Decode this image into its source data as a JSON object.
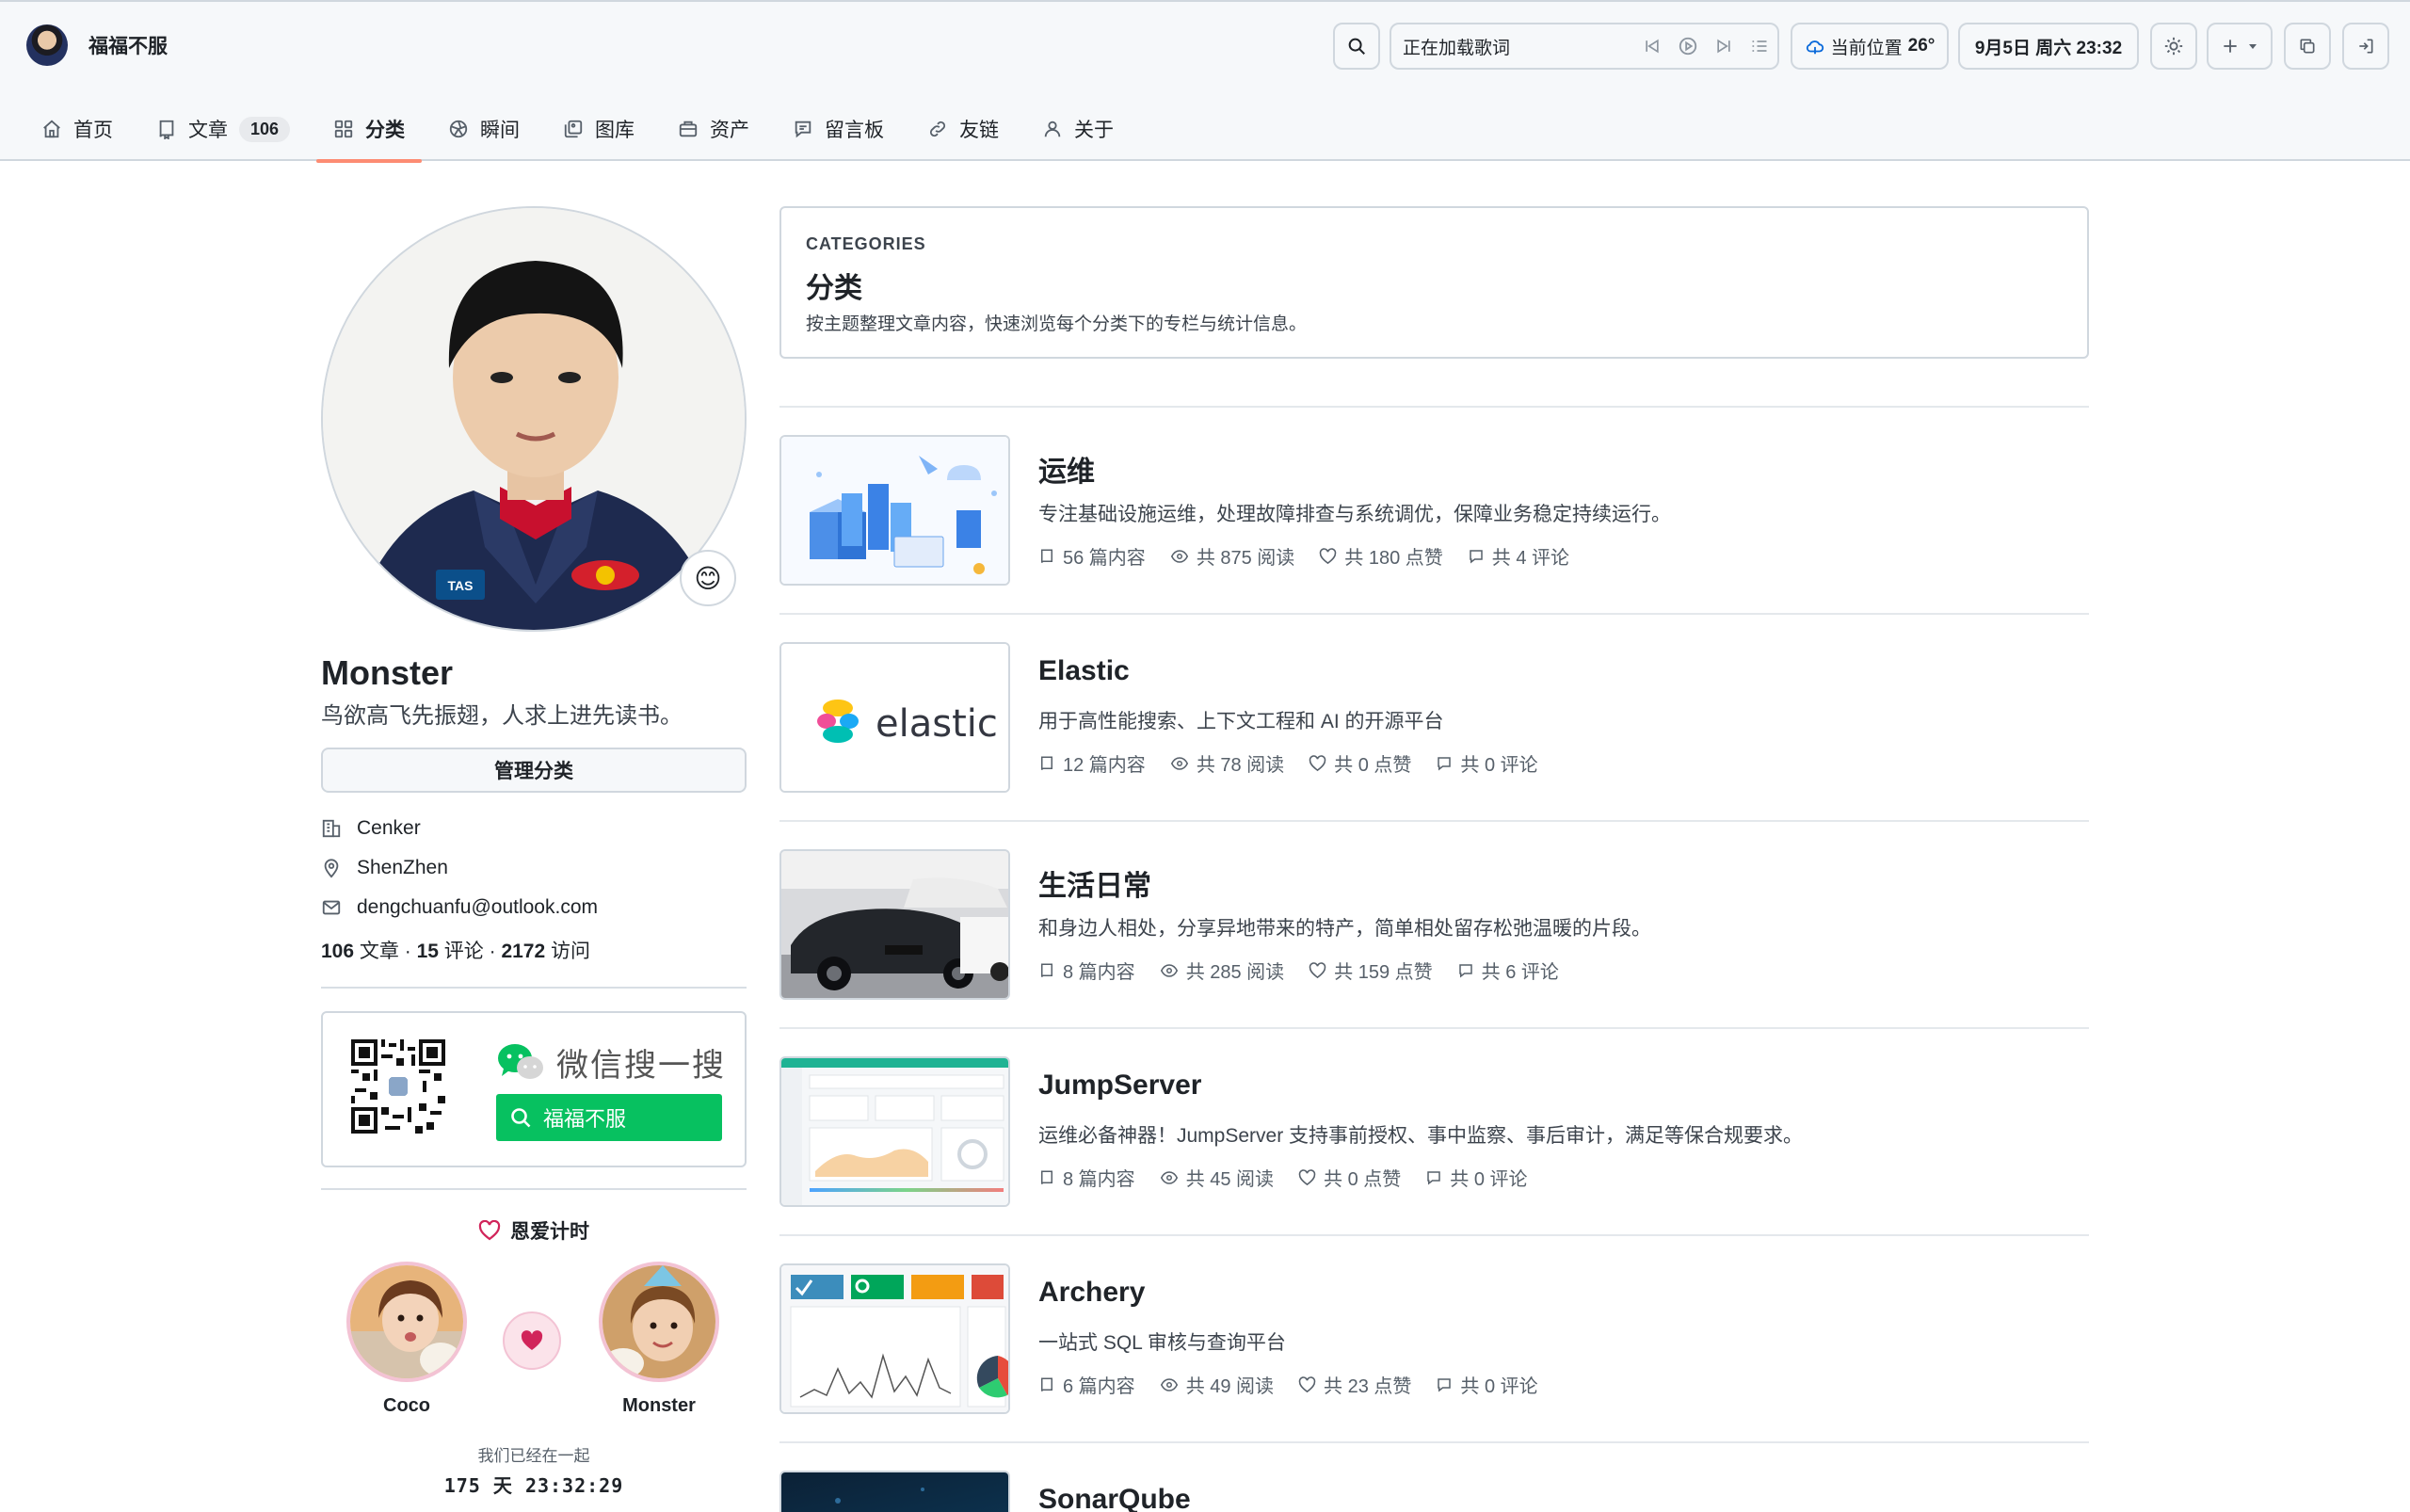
{
  "site": {
    "name": "福福不服"
  },
  "header": {
    "lyric": "正在加载歌词",
    "weather_label": "当前位置",
    "weather_temp": "26°",
    "datetime": "9月5日 周六 23:32"
  },
  "nav": [
    {
      "label": "首页",
      "icon": "home-icon"
    },
    {
      "label": "文章",
      "icon": "book-icon",
      "count": "106"
    },
    {
      "label": "分类",
      "icon": "grid-icon",
      "active": true
    },
    {
      "label": "瞬间",
      "icon": "aperture-icon"
    },
    {
      "label": "图库",
      "icon": "gallery-icon"
    },
    {
      "label": "资产",
      "icon": "briefcase-icon"
    },
    {
      "label": "留言板",
      "icon": "comment-icon"
    },
    {
      "label": "友链",
      "icon": "link-icon"
    },
    {
      "label": "关于",
      "icon": "person-icon"
    }
  ],
  "profile": {
    "name": "Monster",
    "bio": "鸟欲高飞先振翅，人求上进先读书。",
    "manage_label": "管理分类",
    "company": "Cenker",
    "location": "ShenZhen",
    "email": "dengchuanfu@outlook.com",
    "articles": "106",
    "articles_label": "文章",
    "comments": "15",
    "comments_label": "评论",
    "visits": "2172",
    "visits_label": "访问",
    "emoji": "😊"
  },
  "wechat": {
    "title": "微信搜一搜",
    "search_text": "福福不服"
  },
  "love": {
    "title": "恩爱计时",
    "left_name": "Coco",
    "right_name": "Monster",
    "since_label": "我们已经在一起",
    "days": "175",
    "days_unit": "天",
    "time": "23:32:29"
  },
  "categories_header": {
    "eyebrow": "CATEGORIES",
    "title": "分类",
    "description": "按主题整理文章内容，快速浏览每个分类下的专栏与统计信息。"
  },
  "categories": [
    {
      "name": "运维",
      "description": "专注基础设施运维，处理故障排查与系统调优，保障业务稳定持续运行。",
      "posts": "56 篇内容",
      "reads": "共 875 阅读",
      "likes": "共 180 点赞",
      "comments": "共 4 评论",
      "thumb": "isometric-servers"
    },
    {
      "name": "Elastic",
      "description": "用于高性能搜索、上下文工程和 AI 的开源平台",
      "posts": "12 篇内容",
      "reads": "共 78 阅读",
      "likes": "共 0 点赞",
      "comments": "共 0 评论",
      "thumb": "elastic-logo",
      "thumb_text": "elastic"
    },
    {
      "name": "生活日常",
      "description": "和身边人相处，分享异地带来的特产，简单相处留存松弛温暖的片段。",
      "posts": "8 篇内容",
      "reads": "共 285 阅读",
      "likes": "共 159 点赞",
      "comments": "共 6 评论",
      "thumb": "car-showroom"
    },
    {
      "name": "JumpServer",
      "description": "运维必备神器！JumpServer 支持事前授权、事中监察、事后审计，满足等保合规要求。",
      "posts": "8 篇内容",
      "reads": "共 45 阅读",
      "likes": "共 0 点赞",
      "comments": "共 0 评论",
      "thumb": "dashboard"
    },
    {
      "name": "Archery",
      "description": "一站式 SQL 审核与查询平台",
      "posts": "6 篇内容",
      "reads": "共 49 阅读",
      "likes": "共 23 点赞",
      "comments": "共 0 评论",
      "thumb": "archery-dashboard"
    },
    {
      "name": "SonarQube",
      "thumb": "dark-tech"
    }
  ],
  "colors": {
    "accent": "#fd8c73",
    "wechat_green": "#07c160",
    "elastic_yellow": "#fec514",
    "elastic_pink": "#f04e98",
    "elastic_teal": "#00bfb3",
    "elastic_blue": "#1ba9f5"
  }
}
